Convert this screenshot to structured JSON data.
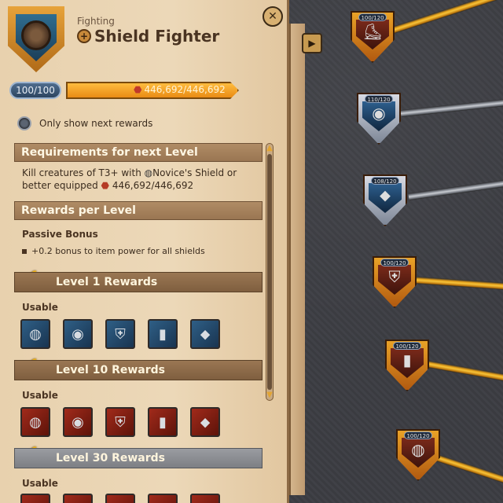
{
  "header": {
    "category": "Fighting",
    "title": "Shield Fighter",
    "close_icon": "close-icon"
  },
  "progress": {
    "level": "100/100",
    "fame": "446,692/446,692",
    "fame_fraction": 1.0
  },
  "toggle": {
    "label": "Only show next rewards"
  },
  "requirements": {
    "heading": "Requirements for next Level",
    "line1_a": "Kill creatures of T3+ with",
    "line1_b": "Novice's Shield or",
    "line2_a": "better equipped",
    "line2_b": "446,692/446,692"
  },
  "rewards": {
    "heading": "Rewards per Level",
    "passive_title": "Passive Bonus",
    "passive_item": "+0.2 bonus to item power for all shields"
  },
  "levels": [
    {
      "title": "Level 1 Rewards",
      "usable": "Usable",
      "items": [
        "shield",
        "round-shield",
        "helm-shield",
        "tower-shield",
        "kite-shield"
      ]
    },
    {
      "title": "Level 10 Rewards",
      "usable": "Usable",
      "items": [
        "shield",
        "round-shield",
        "helm-shield",
        "tower-shield",
        "kite-shield"
      ]
    },
    {
      "title": "Level 30 Rewards",
      "usable": "Usable",
      "items": [
        "shield",
        "round-shield",
        "helm-shield",
        "tower-shield",
        "kite-shield"
      ]
    }
  ],
  "tree_nodes": [
    {
      "label": "100/120",
      "style": "gold"
    },
    {
      "label": "110/120",
      "style": "silver"
    },
    {
      "label": "108/120",
      "style": "silver"
    },
    {
      "label": "100/120",
      "style": "gold"
    },
    {
      "label": "100/120",
      "style": "gold"
    },
    {
      "label": "100/120",
      "style": "gold"
    }
  ],
  "colors": {
    "parchment": "#ecd8b8",
    "gold_accent": "#f2b418",
    "fame_bar": "#ffbc3f"
  }
}
